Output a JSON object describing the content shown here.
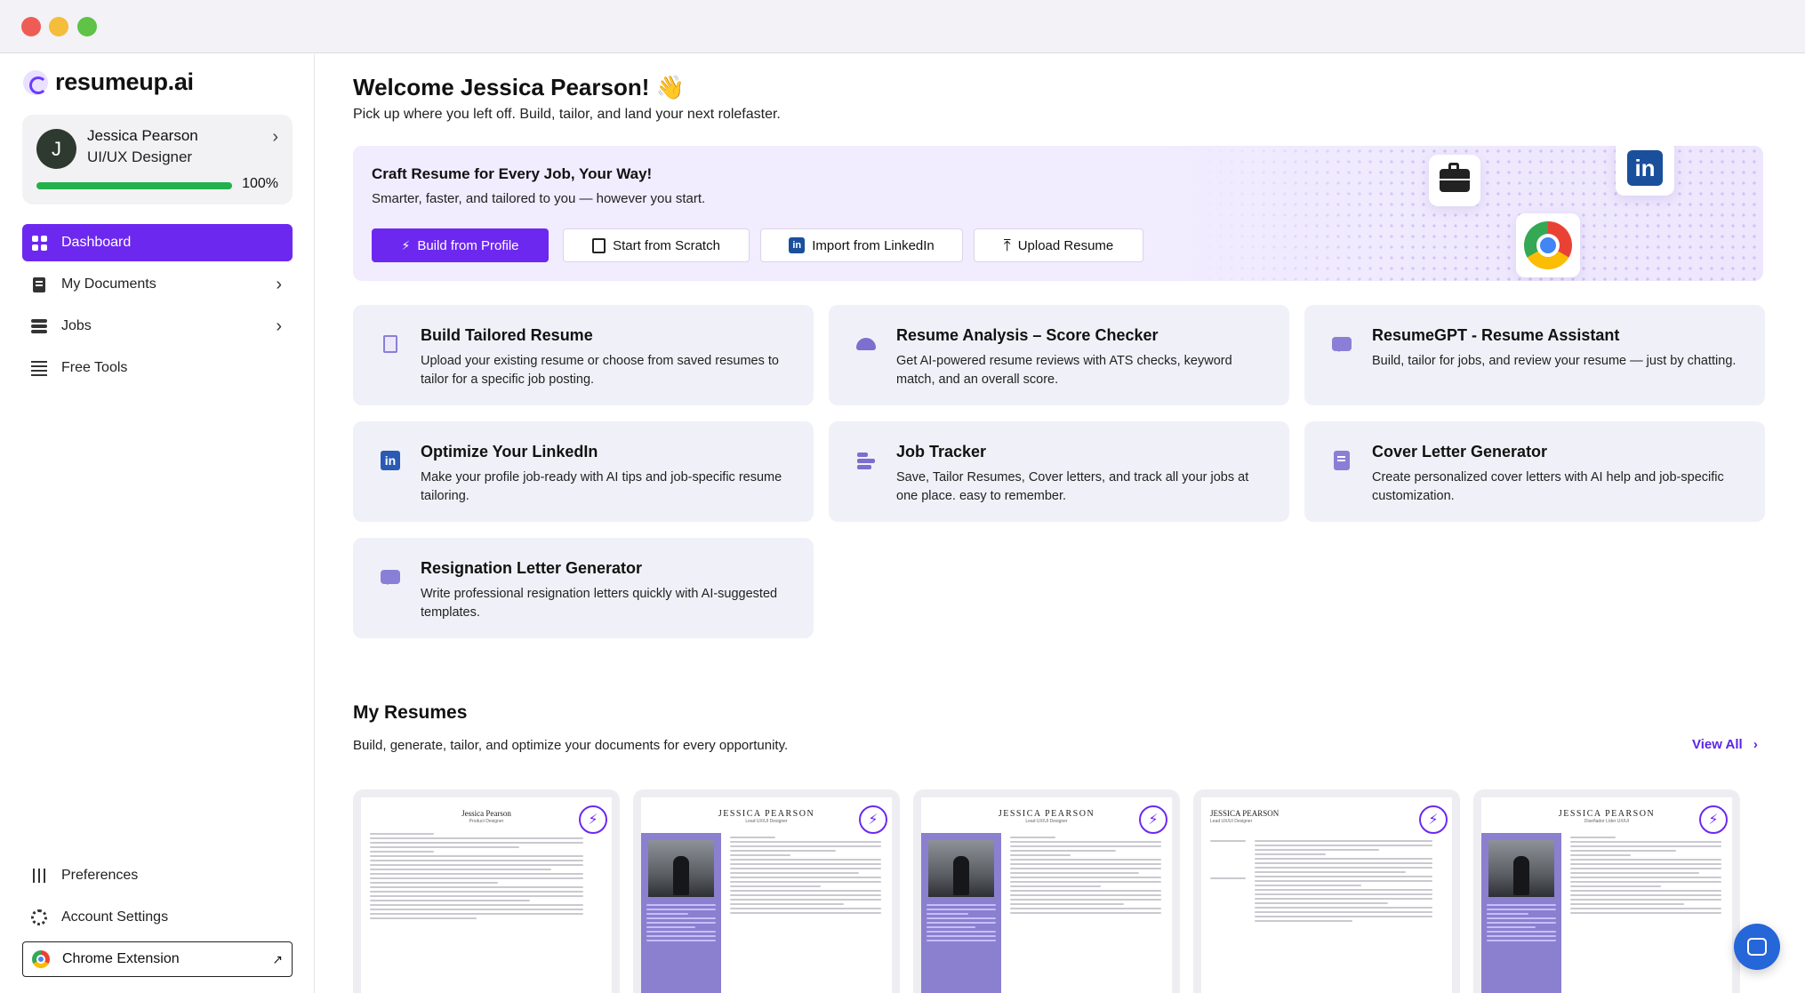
{
  "app": {
    "brand": "resumeup.ai"
  },
  "profile": {
    "initial": "J",
    "name": "Jessica Pearson",
    "role": "UI/UX Designer",
    "completion_pct": "100%",
    "completion_fraction": 1.0
  },
  "sidebar": {
    "items": [
      {
        "label": "Dashboard",
        "icon": "grid-icon",
        "active": true
      },
      {
        "label": "My Documents",
        "icon": "document-icon"
      },
      {
        "label": "Jobs",
        "icon": "jobs-icon"
      },
      {
        "label": "Free Tools",
        "icon": "list-icon"
      }
    ],
    "bottom": {
      "preferences": "Preferences",
      "account_settings": "Account Settings",
      "chrome_extension": "Chrome Extension"
    }
  },
  "header": {
    "welcome": "Welcome Jessica Pearson! 👋",
    "subtitle": "Pick up where you left off. Build, tailor, and land your next rolefaster."
  },
  "hero": {
    "title": "Craft Resume for Every Job, Your Way!",
    "subtitle": "Smarter, faster, and tailored to you — however you start.",
    "buttons": {
      "build_from_profile": "Build from Profile",
      "start_from_scratch": "Start from Scratch",
      "import_from_linkedin": "Import from LinkedIn",
      "upload_resume": "Upload Resume"
    }
  },
  "tools": [
    {
      "title": "Build Tailored Resume",
      "desc": "Upload your existing resume or choose from saved resumes to tailor for a specific job posting.",
      "icon": "document-icon"
    },
    {
      "title": "Resume Analysis – Score Checker",
      "desc": "Get AI-powered resume reviews with ATS checks, keyword match, and an overall score.",
      "icon": "gauge-icon"
    },
    {
      "title": "ResumeGPT - Resume Assistant",
      "desc": "Build, tailor for jobs, and review your resume — just by chatting.",
      "icon": "chat-icon"
    },
    {
      "title": "Optimize Your LinkedIn",
      "desc": "Make your profile job-ready with AI tips and job-specific resume tailoring.",
      "icon": "linkedin-icon"
    },
    {
      "title": "Job Tracker",
      "desc": "Save, Tailor Resumes, Cover letters, and track all your jobs at one place. easy to remember.",
      "icon": "stack-icon"
    },
    {
      "title": "Cover Letter Generator",
      "desc": "Create personalized cover letters with AI help and job-specific customization.",
      "icon": "letter-icon"
    },
    {
      "title": "Resignation Letter Generator",
      "desc": "Write professional resignation letters quickly with AI-suggested templates.",
      "icon": "chat-icon"
    }
  ],
  "my_resumes": {
    "title": "My Resumes",
    "subtitle": "Build, generate, tailor, and optimize your documents for every opportunity.",
    "view_all": "View All",
    "cards": [
      {
        "name": "Jessica Pearson",
        "role": "Product Designer"
      },
      {
        "name": "JESSICA PEARSON",
        "role": "Lead UX/UI Designer"
      },
      {
        "name": "JESSICA PEARSON",
        "role": "Lead UX/UI Designer"
      },
      {
        "name": "JESSICA PEARSON",
        "role": "Lead UX/UI Designer"
      },
      {
        "name": "JESSICA PEARSON",
        "role": "Diseñador Líder UX/UI"
      }
    ]
  },
  "colors": {
    "accent": "#6d28f0",
    "link": "#5b25e8",
    "progress": "#23b14d",
    "card_bg": "#f0f1f8",
    "hero_bg": "#f1ecfe"
  }
}
